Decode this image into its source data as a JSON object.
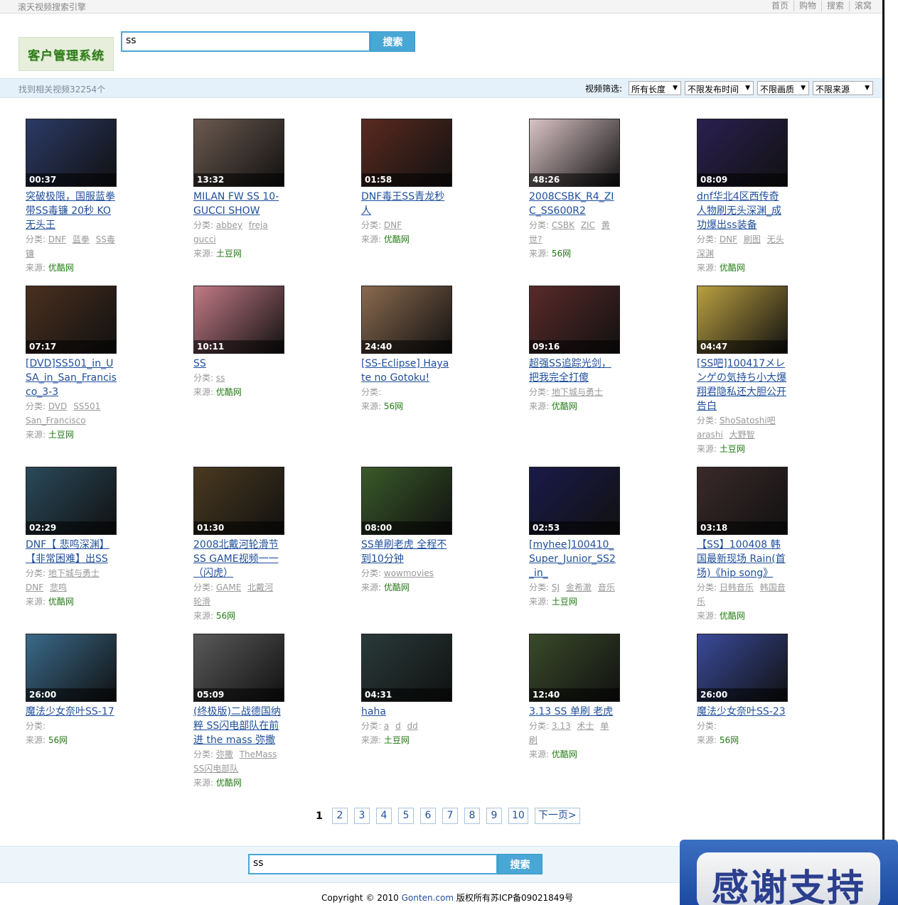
{
  "topbar": {
    "site_name": "滚天视频搜索引擎",
    "nav": [
      "首页",
      "购物",
      "搜索",
      "滚窝"
    ]
  },
  "logo_text": "客户管理系统",
  "search": {
    "query": "ss",
    "button": "搜索"
  },
  "results": {
    "count_text": "找到相关视频32254个",
    "filter_label": "视频筛选:",
    "filters": [
      "所有长度",
      "不限发布时间",
      "不限画质",
      "不限来源"
    ]
  },
  "labels": {
    "category": "分类:",
    "source": "来源:"
  },
  "videos": [
    {
      "duration": "00:37",
      "title": "突破极限，国服蓝拳带SS毒镰 20秒 KO无头王",
      "tags": [
        "DNF",
        "蓝拳",
        "SS毒镰"
      ],
      "source": "优酷网",
      "thumb_color": "#2c3a66"
    },
    {
      "duration": "13:32",
      "title": "MILAN FW SS 10- GUCCI SHOW",
      "tags": [
        "abbey",
        "freja",
        "gucci"
      ],
      "source": "土豆网",
      "thumb_color": "#6b5a50"
    },
    {
      "duration": "01:58",
      "title": "DNF毒王SS青龙秒人",
      "tags": [
        "DNF"
      ],
      "source": "优酷网",
      "thumb_color": "#5a2a20"
    },
    {
      "duration": "48:26",
      "title": "2008CSBK_R4_ZIC_SS600R2",
      "tags": [
        "CSBK",
        "ZIC",
        "黄世?"
      ],
      "source": "56网",
      "thumb_color": "#d9c3c6"
    },
    {
      "duration": "08:09",
      "title": "dnf华北4区西传奇人物刷无头深渊_成功爆出ss装备",
      "tags": [
        "DNF",
        "刷图",
        "无头深渊"
      ],
      "source": "优酷网",
      "thumb_color": "#2a2050"
    },
    {
      "duration": "07:17",
      "title": "[DVD]SS501_in_USA_in_San_Francisco_3-3",
      "tags": [
        "DVD",
        "SS501",
        "San_Francisco"
      ],
      "source": "土豆网",
      "thumb_color": "#4a3020"
    },
    {
      "duration": "10:11",
      "title": "SS",
      "tags": [
        "ss"
      ],
      "source": "优酷网",
      "thumb_color": "#c27a86"
    },
    {
      "duration": "24:40",
      "title": "[SS-Eclipse] Hayate no Gotoku!",
      "tags": [],
      "source": "56网",
      "thumb_color": "#8a6a50"
    },
    {
      "duration": "09:16",
      "title": "超强SS追踪光剑，把我完全打傻",
      "tags": [
        "地下城与勇士"
      ],
      "source": "优酷网",
      "thumb_color": "#5a2a2a"
    },
    {
      "duration": "04:47",
      "title": "[SS吧]100417メレンゲの気持ち小大爆翔君隐私还大胆公开告白",
      "tags": [
        "ShoSatoshi吧",
        "arashi",
        "大野智"
      ],
      "source": "土豆网",
      "thumb_color": "#b9a040"
    },
    {
      "duration": "02:29",
      "title": "DNF【 悲鸣深渊】【非常困难】出SS",
      "tags": [
        "地下城与勇士",
        "DNF",
        "悲鸣"
      ],
      "source": "优酷网",
      "thumb_color": "#2a4a5a"
    },
    {
      "duration": "01:30",
      "title": "2008北戴河轮滑节SS GAME视频一一（闪虎）",
      "tags": [
        "GAME",
        "北戴河",
        "轮滑"
      ],
      "source": "56网",
      "thumb_color": "#4a3a20"
    },
    {
      "duration": "08:00",
      "title": "SS单刷老虎 全程不到10分钟",
      "tags": [
        "wowmovies"
      ],
      "source": "优酷网",
      "thumb_color": "#3a5a2a"
    },
    {
      "duration": "02:53",
      "title": "[myhee]100410_Super_Junior_SS2_in_",
      "tags": [
        "SJ",
        "金希澈",
        "音乐"
      ],
      "source": "土豆网",
      "thumb_color": "#1a1a4a"
    },
    {
      "duration": "03:18",
      "title": "【SS】100408 韩国最新现场 Rain(首场)《hip song》",
      "tags": [
        "日韩音乐",
        "韩国音乐"
      ],
      "source": "优酷网",
      "thumb_color": "#3a2a2a"
    },
    {
      "duration": "26:00",
      "title": "魔法少女奈叶SS-17",
      "tags": [],
      "source": "56网",
      "thumb_color": "#3a6a8a"
    },
    {
      "duration": "05:09",
      "title": "(终极版)二战德国纳粹 SS闪电部队在前进 the mass 弥撒",
      "tags": [
        "弥撒",
        "TheMass",
        "SS闪电部队"
      ],
      "source": "优酷网",
      "thumb_color": "#5a5a5a"
    },
    {
      "duration": "04:31",
      "title": "haha",
      "tags": [
        "a",
        "d",
        "dd"
      ],
      "source": "土豆网",
      "thumb_color": "#2a3a3a"
    },
    {
      "duration": "12:40",
      "title": "3.13 SS 单刷 老虎",
      "tags": [
        "3.13",
        "术士",
        "单刷"
      ],
      "source": "优酷网",
      "thumb_color": "#3a4a2a"
    },
    {
      "duration": "26:00",
      "title": "魔法少女奈叶SS-23",
      "tags": [],
      "source": "56网",
      "thumb_color": "#3a4a9a"
    }
  ],
  "pager": {
    "current": "1",
    "pages": [
      "2",
      "3",
      "4",
      "5",
      "6",
      "7",
      "8",
      "9",
      "10"
    ],
    "next": "下一页>"
  },
  "footer": {
    "copyright_prefix": "Copyright © 2010 ",
    "site_link": "Gonten.com",
    "copyright_suffix": " 版权所有苏ICP备09021849号"
  },
  "banner_text": "感谢支持"
}
